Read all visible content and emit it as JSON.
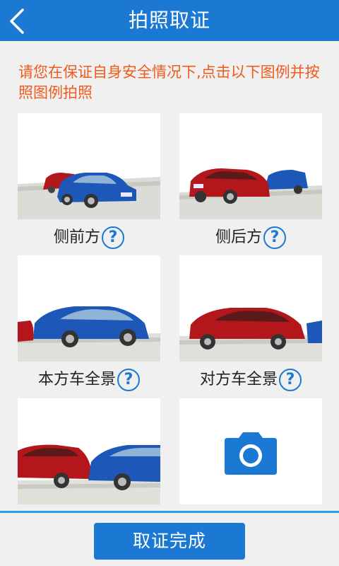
{
  "header": {
    "title": "拍照取证",
    "back_icon": "chevron-left-icon",
    "background": "#1b79d3"
  },
  "notice": {
    "text": "请您在保证自身安全情况下,点击以下图例并按照图例拍照",
    "color": "#f05a1c"
  },
  "photos": [
    {
      "label": "侧前方",
      "help": "?",
      "image": "front-side-collision-example"
    },
    {
      "label": "侧后方",
      "help": "?",
      "image": "rear-side-collision-example"
    },
    {
      "label": "本方车全景",
      "help": "?",
      "image": "own-vehicle-full-view-example"
    },
    {
      "label": "对方车全景",
      "help": "?",
      "image": "other-vehicle-full-view-example"
    },
    {
      "label": "",
      "help": "",
      "image": "collision-point-example"
    },
    {
      "label": "",
      "help": "",
      "image": "camera-icon"
    }
  ],
  "footer": {
    "done_label": "取证完成",
    "accent": "#27a3e6"
  }
}
